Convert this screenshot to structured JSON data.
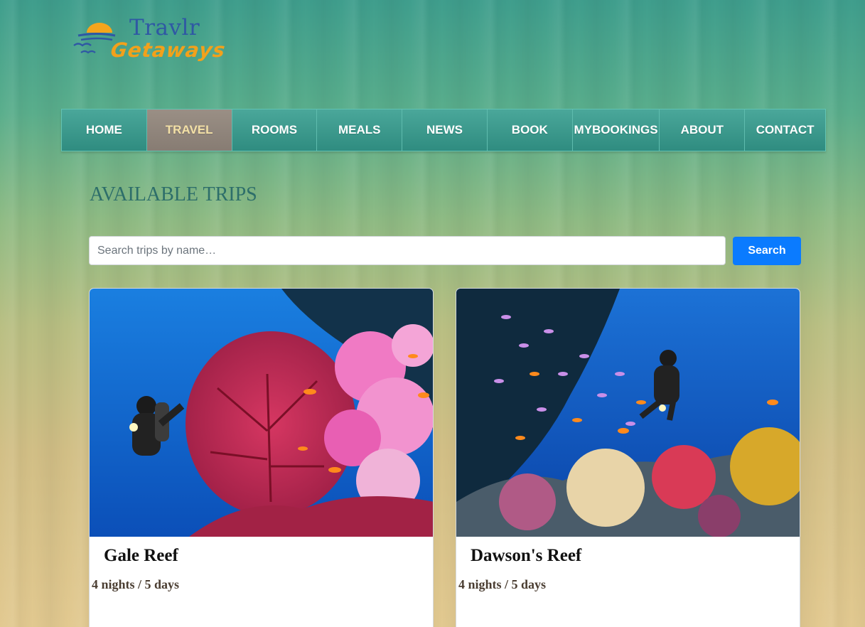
{
  "logo": {
    "title": "Travlr",
    "subtitle": "Getaways"
  },
  "nav": {
    "items": [
      {
        "label": "HOME",
        "active": false
      },
      {
        "label": "TRAVEL",
        "active": true
      },
      {
        "label": "ROOMS",
        "active": false
      },
      {
        "label": "MEALS",
        "active": false
      },
      {
        "label": "NEWS",
        "active": false
      },
      {
        "label": "BOOK",
        "active": false
      },
      {
        "label": "MYBOOKINGS",
        "active": false
      },
      {
        "label": "ABOUT",
        "active": false
      },
      {
        "label": "CONTACT",
        "active": false
      }
    ]
  },
  "main": {
    "title": "AVAILABLE TRIPS",
    "search": {
      "placeholder": "Search trips by name…",
      "value": "",
      "button_label": "Search"
    },
    "trips": [
      {
        "name": "Gale Reef",
        "duration": "4 nights / 5 days",
        "image_icon": "reef-photo"
      },
      {
        "name": "Dawson's Reef",
        "duration": "4 nights / 5 days",
        "image_icon": "reef-photo"
      }
    ]
  },
  "colors": {
    "nav_bg": "#3a9a8d",
    "nav_active_bg": "#8f847a",
    "nav_active_text": "#f3e0a6",
    "title_color": "#2d6e6a",
    "button_bg": "#0a7bff"
  }
}
